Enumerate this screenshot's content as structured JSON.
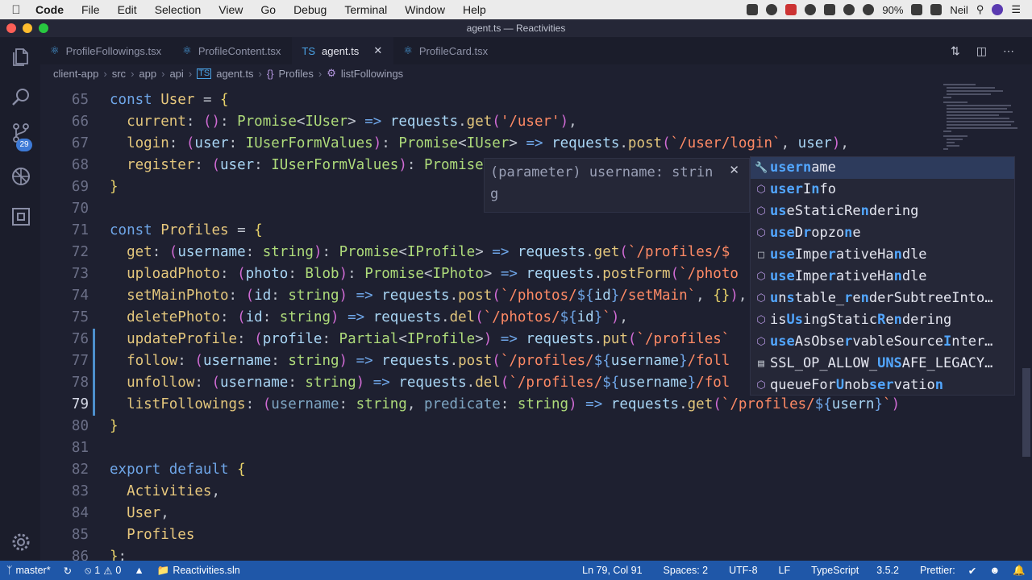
{
  "menubar": {
    "app": "Code",
    "items": [
      "File",
      "Edit",
      "Selection",
      "View",
      "Go",
      "Debug",
      "Terminal",
      "Window",
      "Help"
    ],
    "battery": "90%",
    "user": "Neil"
  },
  "window": {
    "title": "agent.ts — Reactivities"
  },
  "activity": {
    "scm_badge": "29"
  },
  "tabs": [
    {
      "label": "ProfileFollowings.tsx",
      "icon": "react-icon"
    },
    {
      "label": "ProfileContent.tsx",
      "icon": "react-icon"
    },
    {
      "label": "agent.ts",
      "icon": "ts-icon",
      "active": true
    },
    {
      "label": "ProfileCard.tsx",
      "icon": "react-icon"
    }
  ],
  "breadcrumb": [
    "client-app",
    "src",
    "app",
    "api",
    "agent.ts",
    "Profiles",
    "listFollowings"
  ],
  "hint": {
    "text": "(parameter) username: string"
  },
  "suggest": [
    {
      "icon": "wrench-icon",
      "label": "username",
      "selected": true
    },
    {
      "icon": "cube-icon",
      "label": "userInfo"
    },
    {
      "icon": "cube-icon",
      "label": "useStaticRendering"
    },
    {
      "icon": "cube-icon",
      "label": "useDropzone"
    },
    {
      "icon": "square-icon",
      "label": "useImperativeHandle"
    },
    {
      "icon": "cube-icon",
      "label": "useImperativeHandle"
    },
    {
      "icon": "cube-icon",
      "label": "unstable_renderSubtreeIntoContainer"
    },
    {
      "icon": "cube-icon",
      "label": "isUsingStaticRendering"
    },
    {
      "icon": "cube-icon",
      "label": "useAsObservableSourceInternal"
    },
    {
      "icon": "enum-icon",
      "label": "SSL_OP_ALLOW_UNSAFE_LEGACY_RENEGOTIATION"
    },
    {
      "icon": "cube-icon",
      "label": "queueForUnobservation"
    }
  ],
  "status": {
    "branch": "master*",
    "errors": "1",
    "warnings": "0",
    "solution": "Reactivities.sln",
    "position": "Ln 79, Col 91",
    "spaces": "Spaces: 2",
    "encoding": "UTF-8",
    "eol": "LF",
    "language": "TypeScript",
    "version": "3.5.2",
    "prettier": "Prettier:"
  },
  "colors": {
    "accent": "#1f57a8",
    "editor_bg": "#1e2030",
    "highlight": "#52a6ff"
  }
}
